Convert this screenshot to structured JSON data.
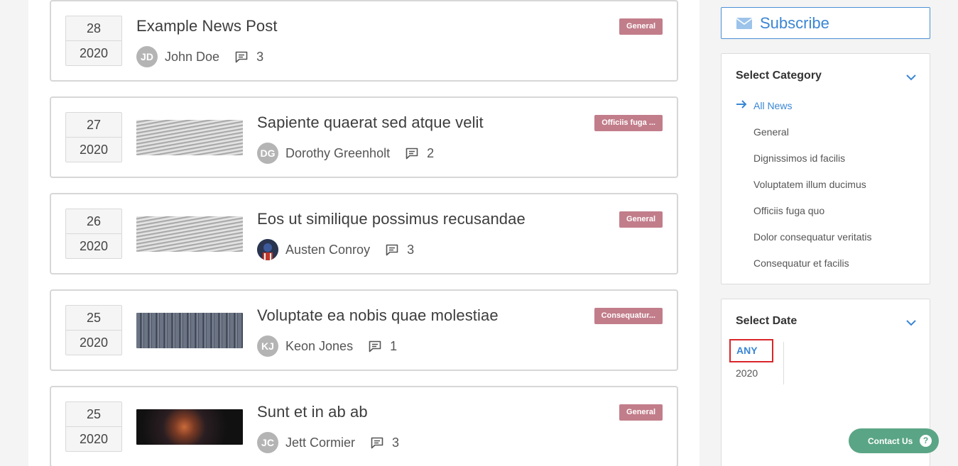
{
  "posts": [
    {
      "day": "28",
      "year": "2020",
      "title": "Example News Post",
      "author": "John Doe",
      "initials": "JD",
      "comments": "3",
      "category": "General",
      "thumbnail": "none"
    },
    {
      "day": "27",
      "year": "2020",
      "title": "Sapiente quaerat sed atque velit",
      "author": "Dorothy Greenholt",
      "initials": "DG",
      "comments": "2",
      "category": "Officiis fuga ...",
      "thumbnail": "newspapers"
    },
    {
      "day": "26",
      "year": "2020",
      "title": "Eos ut similique possimus recusandae",
      "author": "Austen Conroy",
      "initials": "",
      "comments": "3",
      "category": "General",
      "thumbnail": "newspapers"
    },
    {
      "day": "25",
      "year": "2020",
      "title": "Voluptate ea nobis quae molestiae",
      "author": "Keon Jones",
      "initials": "KJ",
      "comments": "1",
      "category": "Consequatur...",
      "thumbnail": "letterpress"
    },
    {
      "day": "25",
      "year": "2020",
      "title": "Sunt et in ab ab",
      "author": "Jett Cormier",
      "initials": "JC",
      "comments": "3",
      "category": "General",
      "thumbnail": "abstract"
    }
  ],
  "sidebar": {
    "subscribe_label": "Subscribe",
    "category": {
      "heading": "Select Category",
      "items": [
        "All News",
        "General",
        "Dignissimos id facilis",
        "Voluptatem illum ducimus",
        "Officiis fuga quo",
        "Dolor consequatur veritatis",
        "Consequatur et facilis"
      ],
      "active_index": 0
    },
    "date": {
      "heading": "Select Date",
      "options": [
        "ANY",
        "2020"
      ],
      "selected": "ANY"
    }
  },
  "contact_label": "Contact Us",
  "contact_icon": "?",
  "colors": {
    "accent": "#3a86d4",
    "badge": "#c27d8a",
    "contact": "#5aa585",
    "highlight": "#d9262a"
  }
}
